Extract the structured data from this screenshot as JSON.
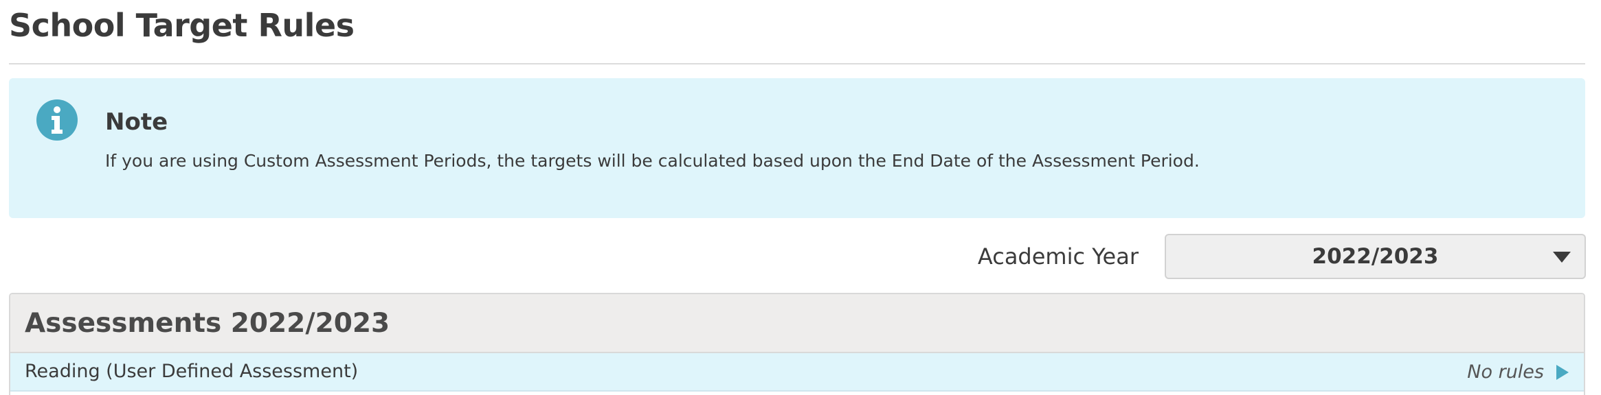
{
  "page": {
    "title": "School Target Rules"
  },
  "note": {
    "icon": "info-icon",
    "heading": "Note",
    "text": "If you are using Custom Assessment Periods, the targets will be calculated based upon the End Date of the Assessment Period."
  },
  "academic_year": {
    "label": "Academic Year",
    "selected": "2022/2023",
    "icon": "chevron-down-icon"
  },
  "assessments": {
    "heading": "Assessments 2022/2023",
    "rows": [
      {
        "name": "Reading (User Defined Assessment)",
        "status": "No rules",
        "icon": "play-icon"
      }
    ]
  },
  "colors": {
    "note_background": "#dff5fb",
    "info_icon": "#4aa9c2",
    "panel_header": "#eeedec",
    "row_background": "#dff5fb",
    "play_icon": "#4aa9c2",
    "text": "#3b3b3b"
  }
}
